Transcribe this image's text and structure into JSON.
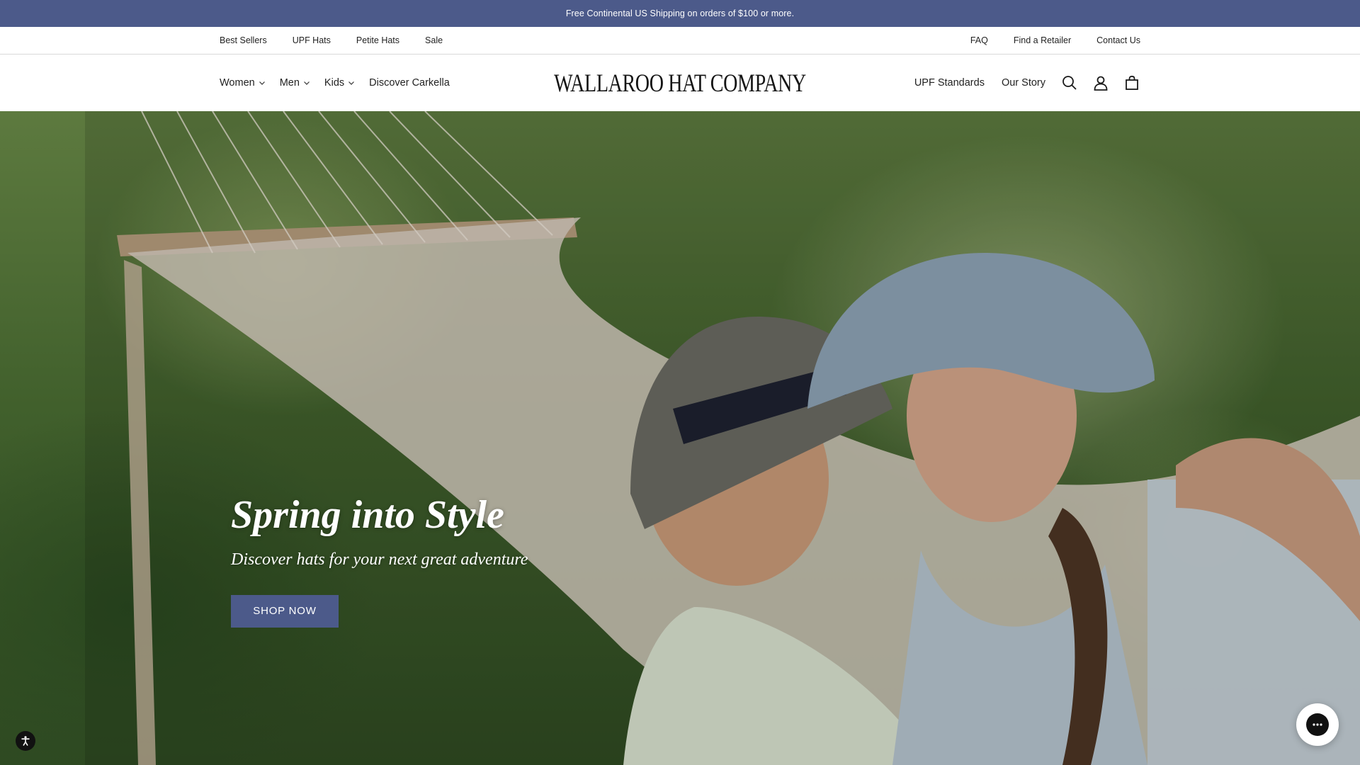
{
  "announcement": {
    "text": "Free Continental US Shipping on orders of $100 or more."
  },
  "utility_nav": {
    "left": [
      "Best Sellers",
      "UPF Hats",
      "Petite Hats",
      "Sale"
    ],
    "right": [
      "FAQ",
      "Find a Retailer",
      "Contact Us"
    ]
  },
  "header": {
    "logo": "WALLAROO HAT COMPANY",
    "nav_left": [
      {
        "label": "Women",
        "dropdown": true
      },
      {
        "label": "Men",
        "dropdown": true
      },
      {
        "label": "Kids",
        "dropdown": true
      },
      {
        "label": "Discover Carkella",
        "dropdown": false
      }
    ],
    "nav_right": [
      "UPF Standards",
      "Our Story"
    ],
    "icons": [
      "search-icon",
      "account-icon",
      "cart-icon"
    ]
  },
  "hero": {
    "title": "Spring into Style",
    "subtitle": "Discover hats for your next great adventure",
    "cta": "SHOP NOW"
  },
  "colors": {
    "brand": "#4c5a8a",
    "text": "#222222",
    "logo": "#141414"
  }
}
